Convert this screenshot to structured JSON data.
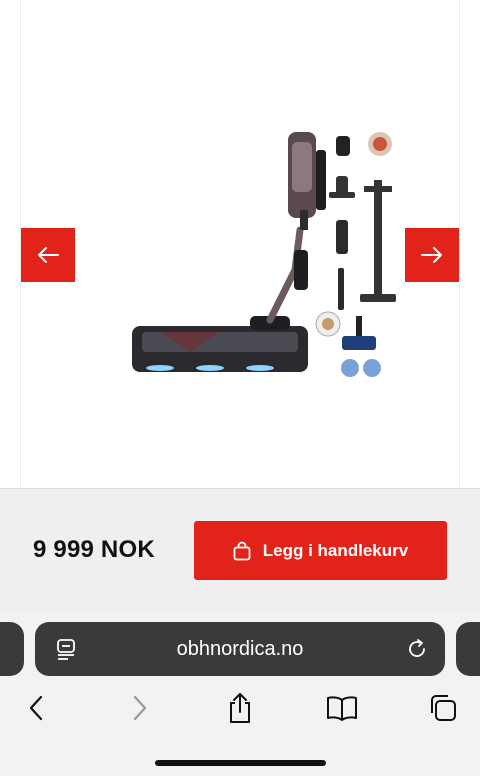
{
  "product": {
    "price": "9 999 NOK",
    "add_to_cart_label": "Legg i handlekurv"
  },
  "browser": {
    "url": "obhnordica.no"
  },
  "colors": {
    "brand_red": "#e2231a",
    "address_bar": "#3a3a3c"
  },
  "icons": {
    "prev": "arrow-left-icon",
    "next": "arrow-right-icon",
    "cart": "shopping-bag-icon",
    "reader": "reader-icon",
    "reload": "reload-icon",
    "back": "chevron-left-icon",
    "forward": "chevron-right-icon",
    "share": "share-icon",
    "bookmarks": "book-icon",
    "tabs": "tabs-icon"
  }
}
